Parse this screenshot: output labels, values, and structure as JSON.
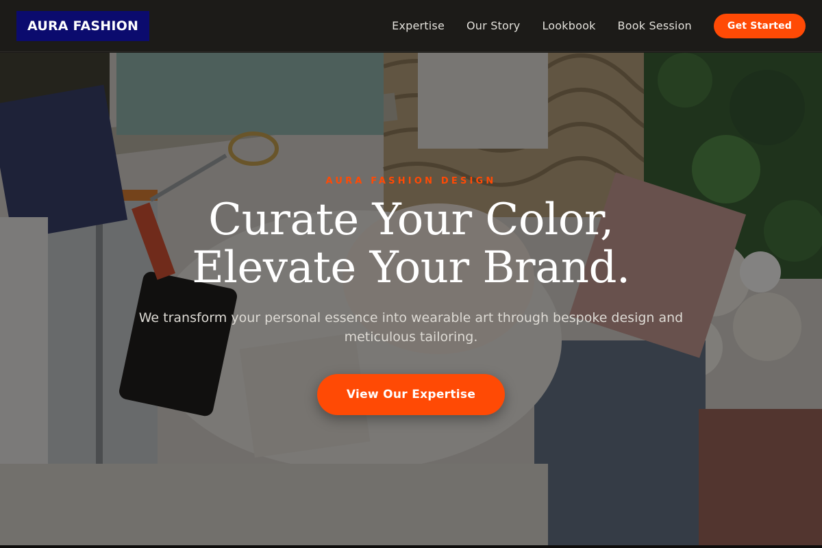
{
  "brand": {
    "logo_text": "AURA FASHION",
    "logo_bg": "#0b0b6e",
    "accent": "#ff4a05"
  },
  "nav": {
    "links": [
      "Expertise",
      "Our Story",
      "Lookbook",
      "Book Session"
    ],
    "cta_label": "Get Started"
  },
  "hero": {
    "eyebrow": "AURA FASHION DESIGN",
    "headline_line1": "Curate Your Color,",
    "headline_line2": "Elevate Your Brand.",
    "subtitle": "We transform your personal essence into wearable art through bespoke design and meticulous tailoring.",
    "cta_label": "View Our Expertise",
    "background_image": "flat-lay-fashion-design-workspace"
  }
}
